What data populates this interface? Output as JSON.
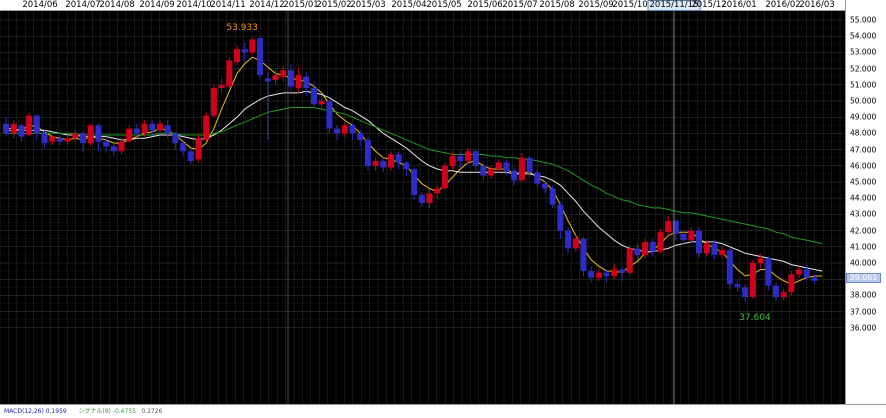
{
  "time_axis": {
    "labels": [
      "2014/06",
      "2014/07",
      "2014/08",
      "2014/09",
      "2014/10",
      "2014/11",
      "2014/12",
      "2015/01",
      "2015/02",
      "2015/03",
      "2015/04",
      "2015/05",
      "2015/06",
      "2015/07",
      "2015/08",
      "2015/09",
      "2015/10",
      "2015/11/15",
      "2015/12",
      "2016/01",
      "2016/02",
      "2016/03"
    ],
    "cursor_label": "2015/11/15"
  },
  "price_axis": {
    "labels": [
      "55.000",
      "54.000",
      "53.000",
      "52.000",
      "51.000",
      "50.000",
      "49.000",
      "48.000",
      "47.000",
      "46.000",
      "45.000",
      "44.000",
      "43.000",
      "42.000",
      "41.000",
      "40.000",
      "39.000",
      "38.000",
      "37.000",
      "36.000"
    ],
    "current_price": "39.061"
  },
  "annotations": {
    "high_label": "53.933",
    "low_label": "37.604"
  },
  "macd": {
    "text_segments": [
      {
        "text": "MACD(12,26) 0.1959",
        "color": "#1a1aa8"
      },
      {
        "text": "シグナル(9) -0.4755",
        "color": "#2e9e2e"
      },
      {
        "text": "0.2726",
        "color": "#555555"
      }
    ]
  },
  "colors": {
    "background": "#000000",
    "grid": "#3c3c3c",
    "up": "#d0021b",
    "down": "#2d2dc6",
    "ma_short": "#e8c020",
    "ma_mid": "#e8e8e8",
    "ma_long": "#1e9a1e",
    "high_label": "#ff8c1a",
    "low_label": "#3cc03c"
  },
  "chart_data": {
    "type": "candlestick",
    "ylim": [
      36,
      55
    ],
    "x": "weekly, 2014/06 – 2016/03",
    "candles": [
      {
        "o": 48.6,
        "c": 48.0,
        "h": 49.0,
        "l": 47.8
      },
      {
        "o": 48.0,
        "c": 48.6,
        "h": 48.8,
        "l": 47.7
      },
      {
        "o": 48.5,
        "c": 47.8,
        "h": 48.6,
        "l": 47.5
      },
      {
        "o": 47.9,
        "c": 49.1,
        "h": 49.3,
        "l": 47.8
      },
      {
        "o": 49.1,
        "c": 48.0,
        "h": 49.2,
        "l": 47.6
      },
      {
        "o": 48.0,
        "c": 47.4,
        "h": 48.2,
        "l": 47.1
      },
      {
        "o": 47.5,
        "c": 47.8,
        "h": 47.9,
        "l": 47.3
      },
      {
        "o": 47.7,
        "c": 47.5,
        "h": 47.9,
        "l": 47.3
      },
      {
        "o": 47.5,
        "c": 47.7,
        "h": 47.9,
        "l": 47.3
      },
      {
        "o": 47.7,
        "c": 48.0,
        "h": 48.2,
        "l": 47.5
      },
      {
        "o": 48.0,
        "c": 47.4,
        "h": 48.1,
        "l": 46.9
      },
      {
        "o": 47.4,
        "c": 48.5,
        "h": 48.6,
        "l": 47.2
      },
      {
        "o": 48.5,
        "c": 47.5,
        "h": 48.6,
        "l": 46.9
      },
      {
        "o": 47.5,
        "c": 47.2,
        "h": 47.7,
        "l": 46.8
      },
      {
        "o": 47.2,
        "c": 46.9,
        "h": 47.4,
        "l": 46.6
      },
      {
        "o": 46.9,
        "c": 47.5,
        "h": 47.7,
        "l": 46.7
      },
      {
        "o": 47.5,
        "c": 48.3,
        "h": 48.5,
        "l": 47.4
      },
      {
        "o": 48.3,
        "c": 48.0,
        "h": 48.6,
        "l": 47.8
      },
      {
        "o": 48.0,
        "c": 48.6,
        "h": 48.8,
        "l": 47.8
      },
      {
        "o": 48.6,
        "c": 48.2,
        "h": 48.8,
        "l": 47.9
      },
      {
        "o": 48.2,
        "c": 48.6,
        "h": 48.8,
        "l": 48.0
      },
      {
        "o": 48.5,
        "c": 48.0,
        "h": 48.8,
        "l": 47.7
      },
      {
        "o": 48.0,
        "c": 47.4,
        "h": 48.1,
        "l": 47.0
      },
      {
        "o": 47.4,
        "c": 46.9,
        "h": 47.5,
        "l": 46.6
      },
      {
        "o": 46.9,
        "c": 46.3,
        "h": 47.0,
        "l": 46.1
      },
      {
        "o": 46.4,
        "c": 47.7,
        "h": 47.9,
        "l": 46.2
      },
      {
        "o": 47.6,
        "c": 49.1,
        "h": 49.3,
        "l": 47.5
      },
      {
        "o": 49.1,
        "c": 50.8,
        "h": 51.0,
        "l": 49.0
      },
      {
        "o": 50.8,
        "c": 51.0,
        "h": 51.4,
        "l": 50.5
      },
      {
        "o": 50.9,
        "c": 52.5,
        "h": 52.7,
        "l": 50.8
      },
      {
        "o": 52.4,
        "c": 53.2,
        "h": 53.4,
        "l": 52.2
      },
      {
        "o": 53.2,
        "c": 53.0,
        "h": 53.6,
        "l": 52.4
      },
      {
        "o": 53.0,
        "c": 53.8,
        "h": 53.9,
        "l": 52.9
      },
      {
        "o": 53.9,
        "c": 51.6,
        "h": 53.9,
        "l": 51.4
      },
      {
        "o": 51.4,
        "c": 51.2,
        "h": 51.8,
        "l": 47.6
      },
      {
        "o": 51.3,
        "c": 51.6,
        "h": 51.9,
        "l": 51.0
      },
      {
        "o": 51.5,
        "c": 51.9,
        "h": 52.2,
        "l": 51.2
      },
      {
        "o": 51.9,
        "c": 50.9,
        "h": 52.3,
        "l": 50.6
      },
      {
        "o": 50.8,
        "c": 51.6,
        "h": 52.1,
        "l": 50.5
      },
      {
        "o": 51.5,
        "c": 50.8,
        "h": 51.8,
        "l": 50.3
      },
      {
        "o": 50.8,
        "c": 49.8,
        "h": 51.2,
        "l": 49.6
      },
      {
        "o": 49.8,
        "c": 50.0,
        "h": 50.3,
        "l": 49.5
      },
      {
        "o": 50.0,
        "c": 48.3,
        "h": 50.1,
        "l": 48.0
      },
      {
        "o": 48.3,
        "c": 48.0,
        "h": 48.5,
        "l": 47.6
      },
      {
        "o": 48.0,
        "c": 48.5,
        "h": 48.7,
        "l": 47.8
      },
      {
        "o": 48.5,
        "c": 48.0,
        "h": 48.6,
        "l": 47.6
      },
      {
        "o": 48.0,
        "c": 47.6,
        "h": 48.2,
        "l": 47.2
      },
      {
        "o": 47.6,
        "c": 46.0,
        "h": 47.8,
        "l": 45.7
      },
      {
        "o": 46.0,
        "c": 46.3,
        "h": 46.5,
        "l": 45.7
      },
      {
        "o": 46.3,
        "c": 45.9,
        "h": 46.5,
        "l": 45.6
      },
      {
        "o": 45.9,
        "c": 46.7,
        "h": 46.9,
        "l": 45.7
      },
      {
        "o": 46.7,
        "c": 46.2,
        "h": 46.9,
        "l": 45.8
      },
      {
        "o": 46.2,
        "c": 45.8,
        "h": 46.3,
        "l": 45.4
      },
      {
        "o": 45.8,
        "c": 44.2,
        "h": 45.9,
        "l": 43.9
      },
      {
        "o": 44.2,
        "c": 43.7,
        "h": 44.4,
        "l": 43.5
      },
      {
        "o": 43.7,
        "c": 44.3,
        "h": 44.5,
        "l": 43.4
      },
      {
        "o": 44.3,
        "c": 44.6,
        "h": 44.8,
        "l": 44.0
      },
      {
        "o": 44.6,
        "c": 46.0,
        "h": 46.2,
        "l": 44.5
      },
      {
        "o": 46.0,
        "c": 46.6,
        "h": 46.9,
        "l": 45.8
      },
      {
        "o": 46.6,
        "c": 46.3,
        "h": 46.9,
        "l": 45.9
      },
      {
        "o": 46.3,
        "c": 46.9,
        "h": 47.1,
        "l": 46.1
      },
      {
        "o": 46.9,
        "c": 46.0,
        "h": 47.0,
        "l": 45.7
      },
      {
        "o": 46.0,
        "c": 45.4,
        "h": 46.2,
        "l": 45.1
      },
      {
        "o": 45.4,
        "c": 45.8,
        "h": 46.0,
        "l": 45.2
      },
      {
        "o": 45.8,
        "c": 46.2,
        "h": 46.4,
        "l": 45.6
      },
      {
        "o": 46.2,
        "c": 45.7,
        "h": 46.4,
        "l": 45.4
      },
      {
        "o": 45.7,
        "c": 45.1,
        "h": 45.9,
        "l": 44.8
      },
      {
        "o": 45.1,
        "c": 46.5,
        "h": 46.8,
        "l": 45.0
      },
      {
        "o": 46.5,
        "c": 45.6,
        "h": 46.6,
        "l": 45.3
      },
      {
        "o": 45.6,
        "c": 44.9,
        "h": 45.8,
        "l": 44.7
      },
      {
        "o": 44.9,
        "c": 44.6,
        "h": 45.1,
        "l": 44.3
      },
      {
        "o": 44.6,
        "c": 43.6,
        "h": 44.8,
        "l": 43.4
      },
      {
        "o": 43.6,
        "c": 42.0,
        "h": 43.8,
        "l": 41.5
      },
      {
        "o": 42.0,
        "c": 40.9,
        "h": 42.2,
        "l": 40.6
      },
      {
        "o": 40.9,
        "c": 41.5,
        "h": 41.7,
        "l": 40.7
      },
      {
        "o": 41.5,
        "c": 39.5,
        "h": 41.6,
        "l": 39.2
      },
      {
        "o": 39.5,
        "c": 39.1,
        "h": 39.8,
        "l": 38.8
      },
      {
        "o": 39.1,
        "c": 39.4,
        "h": 39.7,
        "l": 38.9
      },
      {
        "o": 39.4,
        "c": 39.2,
        "h": 39.6,
        "l": 38.8
      },
      {
        "o": 39.2,
        "c": 39.6,
        "h": 39.9,
        "l": 39.0
      },
      {
        "o": 39.6,
        "c": 39.4,
        "h": 39.8,
        "l": 38.9
      },
      {
        "o": 39.4,
        "c": 40.9,
        "h": 41.1,
        "l": 39.3
      },
      {
        "o": 40.9,
        "c": 40.5,
        "h": 41.2,
        "l": 40.2
      },
      {
        "o": 40.5,
        "c": 41.3,
        "h": 41.5,
        "l": 40.3
      },
      {
        "o": 41.3,
        "c": 40.7,
        "h": 41.5,
        "l": 40.4
      },
      {
        "o": 40.7,
        "c": 41.9,
        "h": 42.1,
        "l": 40.6
      },
      {
        "o": 41.9,
        "c": 42.6,
        "h": 42.9,
        "l": 41.7
      },
      {
        "o": 42.6,
        "c": 41.8,
        "h": 42.7,
        "l": 41.4
      },
      {
        "o": 41.8,
        "c": 41.4,
        "h": 42.0,
        "l": 41.1
      },
      {
        "o": 41.4,
        "c": 42.0,
        "h": 42.2,
        "l": 41.2
      },
      {
        "o": 42.0,
        "c": 40.6,
        "h": 42.2,
        "l": 40.3
      },
      {
        "o": 40.6,
        "c": 41.2,
        "h": 41.4,
        "l": 40.4
      },
      {
        "o": 41.2,
        "c": 40.5,
        "h": 41.4,
        "l": 40.2
      },
      {
        "o": 40.5,
        "c": 40.8,
        "h": 41.0,
        "l": 40.3
      },
      {
        "o": 40.8,
        "c": 38.7,
        "h": 40.9,
        "l": 38.4
      },
      {
        "o": 38.7,
        "c": 38.5,
        "h": 38.9,
        "l": 38.2
      },
      {
        "o": 38.5,
        "c": 37.9,
        "h": 38.7,
        "l": 37.6
      },
      {
        "o": 37.9,
        "c": 40.0,
        "h": 40.2,
        "l": 37.8
      },
      {
        "o": 40.0,
        "c": 40.3,
        "h": 40.6,
        "l": 39.7
      },
      {
        "o": 40.3,
        "c": 38.6,
        "h": 40.4,
        "l": 38.3
      },
      {
        "o": 38.6,
        "c": 37.9,
        "h": 38.8,
        "l": 37.6
      },
      {
        "o": 37.9,
        "c": 38.2,
        "h": 38.4,
        "l": 37.7
      },
      {
        "o": 38.2,
        "c": 39.3,
        "h": 39.5,
        "l": 38.0
      },
      {
        "o": 39.3,
        "c": 39.6,
        "h": 39.8,
        "l": 39.1
      },
      {
        "o": 39.6,
        "c": 39.1,
        "h": 39.9,
        "l": 38.9
      },
      {
        "o": 39.1,
        "c": 38.9,
        "h": 39.3,
        "l": 38.7
      }
    ],
    "series": [
      {
        "role": "short-MA",
        "values": [
          48.3,
          48.3,
          48.2,
          48.5,
          48.4,
          48.1,
          47.8,
          47.7,
          47.6,
          47.7,
          47.6,
          47.8,
          47.7,
          47.6,
          47.4,
          47.4,
          47.6,
          47.8,
          48.0,
          48.1,
          48.3,
          48.2,
          47.9,
          47.5,
          47.1,
          47.0,
          47.4,
          48.3,
          49.5,
          50.6,
          51.7,
          52.3,
          52.7,
          52.5,
          52.1,
          51.7,
          51.6,
          51.4,
          51.3,
          51.2,
          50.9,
          50.5,
          49.8,
          49.2,
          48.8,
          48.5,
          48.0,
          47.4,
          46.9,
          46.5,
          46.4,
          46.2,
          46.0,
          45.4,
          44.9,
          44.6,
          44.4,
          44.8,
          45.3,
          45.8,
          46.2,
          46.3,
          46.0,
          45.8,
          45.8,
          45.8,
          45.5,
          45.6,
          45.6,
          45.3,
          45.0,
          44.5,
          43.6,
          42.6,
          41.7,
          40.9,
          40.2,
          39.8,
          39.5,
          39.5,
          39.4,
          39.8,
          40.1,
          40.6,
          40.8,
          41.2,
          41.7,
          41.9,
          41.9,
          41.9,
          41.5,
          41.2,
          40.9,
          40.7,
          40.1,
          39.6,
          39.2,
          39.3,
          39.6,
          39.6,
          39.2,
          38.9,
          38.7,
          38.9,
          39.1,
          39.2,
          39.2
        ]
      },
      {
        "role": "mid-MA",
        "values": [
          48.2,
          48.2,
          48.2,
          48.2,
          48.2,
          48.2,
          48.1,
          48.0,
          47.9,
          47.9,
          47.8,
          47.8,
          47.8,
          47.8,
          47.7,
          47.6,
          47.6,
          47.7,
          47.7,
          47.8,
          47.9,
          47.9,
          47.9,
          47.8,
          47.7,
          47.6,
          47.7,
          47.9,
          48.2,
          48.6,
          49.0,
          49.5,
          49.8,
          50.1,
          50.3,
          50.4,
          50.5,
          50.5,
          50.5,
          50.6,
          50.5,
          50.4,
          50.2,
          49.9,
          49.6,
          49.4,
          49.1,
          48.8,
          48.4,
          48.0,
          47.7,
          47.4,
          47.1,
          46.7,
          46.3,
          46.0,
          45.8,
          45.7,
          45.7,
          45.6,
          45.6,
          45.6,
          45.6,
          45.6,
          45.6,
          45.6,
          45.5,
          45.5,
          45.5,
          45.4,
          45.3,
          45.1,
          44.8,
          44.3,
          43.8,
          43.2,
          42.7,
          42.2,
          41.8,
          41.4,
          41.1,
          40.9,
          40.8,
          40.7,
          40.7,
          40.8,
          40.9,
          41.1,
          41.2,
          41.3,
          41.3,
          41.3,
          41.3,
          41.2,
          41.0,
          40.8,
          40.6,
          40.5,
          40.4,
          40.3,
          40.2,
          40.1,
          39.9,
          39.8,
          39.7,
          39.6,
          39.5
        ]
      },
      {
        "role": "long-MA",
        "values": [
          48.0,
          48.0,
          48.0,
          48.0,
          48.0,
          48.0,
          48.0,
          48.0,
          48.0,
          48.0,
          47.9,
          47.9,
          47.9,
          47.9,
          47.9,
          47.9,
          47.9,
          47.9,
          47.9,
          47.9,
          48.0,
          48.0,
          48.0,
          47.9,
          47.9,
          47.9,
          47.9,
          48.0,
          48.1,
          48.3,
          48.5,
          48.7,
          48.9,
          49.1,
          49.3,
          49.4,
          49.5,
          49.6,
          49.6,
          49.6,
          49.6,
          49.5,
          49.4,
          49.3,
          49.2,
          49.0,
          48.8,
          48.6,
          48.4,
          48.2,
          48.0,
          47.8,
          47.6,
          47.4,
          47.2,
          47.0,
          46.9,
          46.8,
          46.7,
          46.7,
          46.7,
          46.7,
          46.7,
          46.6,
          46.6,
          46.5,
          46.5,
          46.4,
          46.4,
          46.3,
          46.2,
          46.1,
          45.9,
          45.7,
          45.4,
          45.1,
          44.8,
          44.6,
          44.3,
          44.1,
          43.9,
          43.8,
          43.6,
          43.5,
          43.4,
          43.4,
          43.3,
          43.2,
          43.1,
          43.1,
          43.0,
          42.9,
          42.8,
          42.7,
          42.6,
          42.5,
          42.4,
          42.3,
          42.2,
          42.1,
          41.9,
          41.8,
          41.6,
          41.5,
          41.4,
          41.3,
          41.2
        ]
      }
    ]
  }
}
